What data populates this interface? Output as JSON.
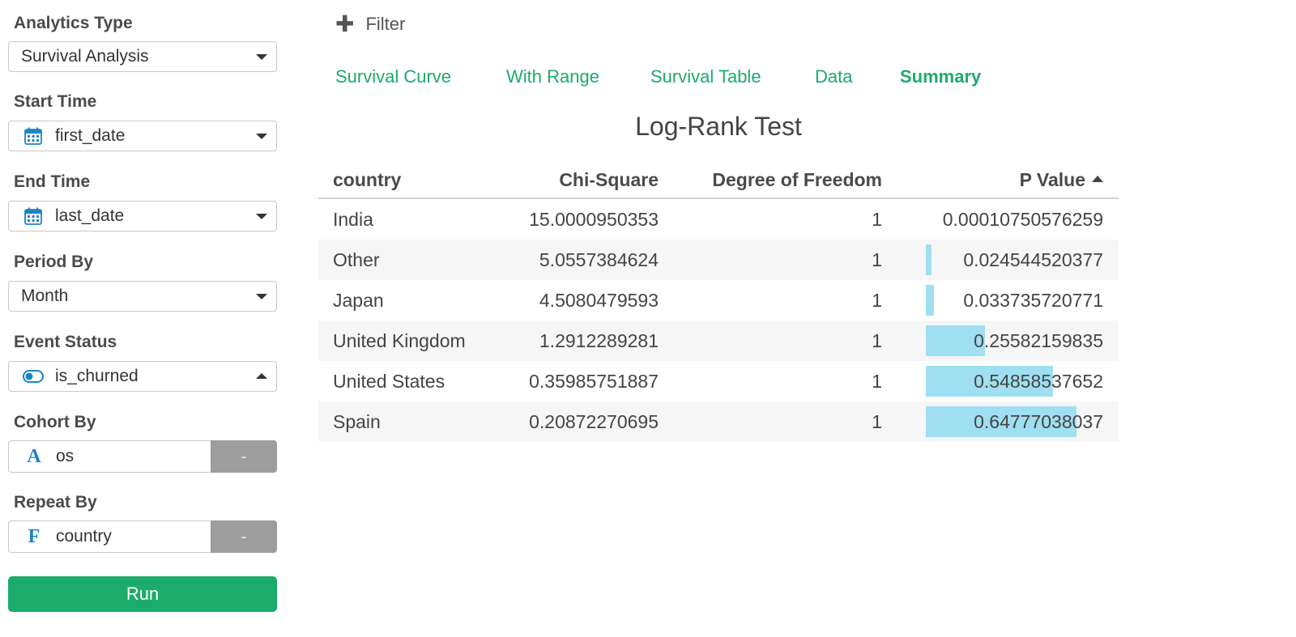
{
  "sidebar": {
    "analytics_type": {
      "label": "Analytics Type",
      "value": "Survival Analysis"
    },
    "start_time": {
      "label": "Start Time",
      "value": "first_date",
      "icon": "calendar-icon"
    },
    "end_time": {
      "label": "End Time",
      "value": "last_date",
      "icon": "calendar-icon"
    },
    "period_by": {
      "label": "Period By",
      "value": "Month"
    },
    "event_status": {
      "label": "Event Status",
      "value": "is_churned",
      "icon": "toggle-icon"
    },
    "cohort_by": {
      "label": "Cohort By",
      "value": "os",
      "type_glyph": "A",
      "button": "-"
    },
    "repeat_by": {
      "label": "Repeat By",
      "value": "country",
      "type_glyph": "F",
      "button": "-"
    },
    "run_label": "Run"
  },
  "main": {
    "filter_label": "Filter",
    "tabs": [
      {
        "label": "Survival Curve",
        "active": false
      },
      {
        "label": "With Range",
        "active": false
      },
      {
        "label": "Survival Table",
        "active": false
      },
      {
        "label": "Data",
        "active": false
      },
      {
        "label": "Summary",
        "active": true
      }
    ],
    "table": {
      "title": "Log-Rank Test",
      "columns": [
        "country",
        "Chi-Square",
        "Degree of Freedom",
        "P Value"
      ],
      "sort": {
        "column": "P Value",
        "direction": "ascending"
      },
      "bar_color": "#9fdff2",
      "rows": [
        {
          "country": "India",
          "chi_square": "15.0000950353",
          "dof": "1",
          "p_value": "0.00010750576259"
        },
        {
          "country": "Other",
          "chi_square": "5.0557384624",
          "dof": "1",
          "p_value": "0.024544520377"
        },
        {
          "country": "Japan",
          "chi_square": "4.5080479593",
          "dof": "1",
          "p_value": "0.033735720771"
        },
        {
          "country": "United Kingdom",
          "chi_square": "1.2912289281",
          "dof": "1",
          "p_value": "0.25582159835"
        },
        {
          "country": "United States",
          "chi_square": "0.35985751887",
          "dof": "1",
          "p_value": "0.54858537652"
        },
        {
          "country": "Spain",
          "chi_square": "0.20872270695",
          "dof": "1",
          "p_value": "0.64777038037"
        }
      ]
    }
  },
  "colors": {
    "accent": "#1bab6b",
    "icon_blue": "#1c84c6",
    "button_gray": "#9d9d9d"
  }
}
